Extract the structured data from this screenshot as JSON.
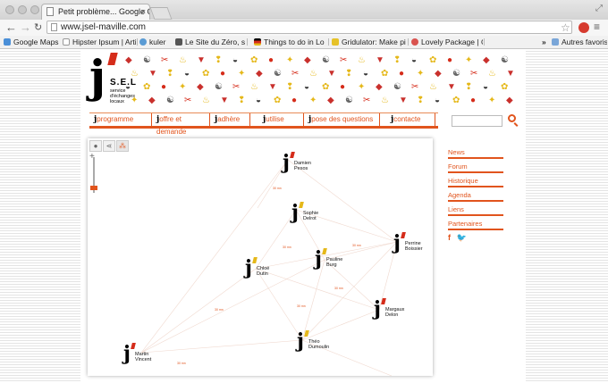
{
  "browser": {
    "tab_title": "Petit problème... Google Chr",
    "url": "www.jsel-maville.com",
    "bookmarks": [
      {
        "label": "Google Maps",
        "icon": "google-maps-icon",
        "color": "#4a8fd8"
      },
      {
        "label": "Hipster Ipsum | Arti",
        "icon": "page-icon",
        "color": "#cccccc"
      },
      {
        "label": "kuler",
        "icon": "kuler-icon",
        "color": "#5a9bd4"
      },
      {
        "label": "Le Site du Zéro, site",
        "icon": "sdz-icon",
        "color": "#555555"
      },
      {
        "label": "Things to do in Lo",
        "icon": "flag-icon",
        "color": "#d4a017"
      },
      {
        "label": "Gridulator: Make pi",
        "icon": "grid-icon",
        "color": "#e6c229"
      },
      {
        "label": "Lovely Package | Cu",
        "icon": "heart-icon",
        "color": "#d9534f"
      }
    ],
    "more_label": "»",
    "other_bookmarks": "Autres favoris"
  },
  "site": {
    "logo_letter": "j",
    "logo_title": "S.E.L",
    "logo_subtitle": "service d'échanges locaux",
    "nav": [
      {
        "j": "j",
        "label": "programme"
      },
      {
        "j": "j",
        "label": "offre et demande"
      },
      {
        "j": "j",
        "label": "adhère"
      },
      {
        "j": "j",
        "label": "utilise"
      },
      {
        "j": "j",
        "label": "pose des questions"
      },
      {
        "j": "j",
        "label": "contacte"
      }
    ],
    "side_links": [
      "News",
      "Forum",
      "Historique",
      "Agenda",
      "Liens",
      "Partenaires"
    ],
    "social": [
      "f",
      "twitter"
    ]
  },
  "graph": {
    "tools": [
      "person-icon",
      "share-icon",
      "network-icon"
    ],
    "zoom_plus": "+",
    "nodes": [
      {
        "name": "Damien",
        "second": "Pesos",
        "accent": "#d52c1a"
      },
      {
        "name": "Sophie",
        "second": "Delrot",
        "accent": "#e5b81a"
      },
      {
        "name": "Perrine",
        "second": "Boissier",
        "accent": "#d52c1a"
      },
      {
        "name": "Pauline",
        "second": "Burg",
        "accent": "#e5b81a"
      },
      {
        "name": "Chloé",
        "second": "Dutin",
        "accent": "#e5b81a"
      },
      {
        "name": "Margaux",
        "second": "Delon",
        "accent": "#d52c1a"
      },
      {
        "name": "Théo",
        "second": "Dumoulin",
        "accent": "#e5b81a"
      },
      {
        "name": "Martin",
        "second": "Vincent",
        "accent": "#d52c1a"
      }
    ],
    "edge_label": "30 mn"
  },
  "colors": {
    "accent": "#e1541d",
    "red": "#d52c1a",
    "yellow": "#e5b81a"
  }
}
